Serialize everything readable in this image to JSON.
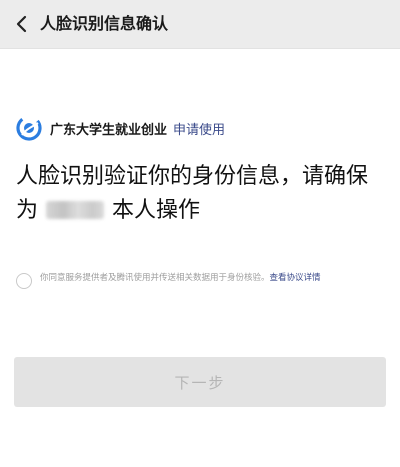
{
  "navbar": {
    "title": "人脸识别信息确认",
    "back_icon": "chevron-left-icon"
  },
  "app": {
    "name": "广东大学生就业创业",
    "apply_text": "申请使用",
    "logo_icon": "app-logo-icon",
    "brand_color": "#2b7de0"
  },
  "heading": {
    "line1": "人脸识别验证你的身份信息，请确保",
    "prefix": "为",
    "suffix": "本人操作"
  },
  "agreement": {
    "text": "你同意服务提供者及腾讯使用并传送相关数据用于身份核验。",
    "link": "查看协议详情",
    "checked": false
  },
  "next_button": {
    "label": "下一步",
    "enabled": false
  }
}
